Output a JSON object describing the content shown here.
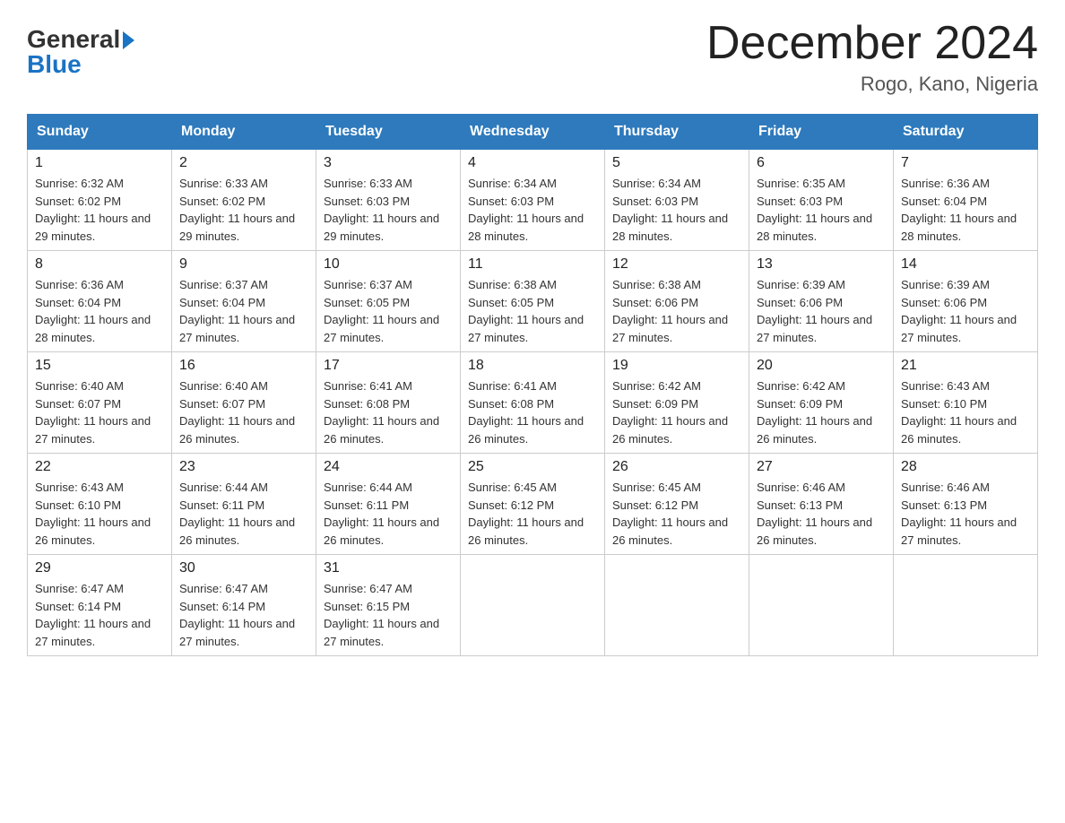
{
  "logo": {
    "text_general": "General",
    "text_blue": "Blue",
    "triangle_symbol": "▶"
  },
  "title": "December 2024",
  "location": "Rogo, Kano, Nigeria",
  "days_of_week": [
    "Sunday",
    "Monday",
    "Tuesday",
    "Wednesday",
    "Thursday",
    "Friday",
    "Saturday"
  ],
  "weeks": [
    [
      {
        "day": "1",
        "sunrise": "6:32 AM",
        "sunset": "6:02 PM",
        "daylight": "11 hours and 29 minutes."
      },
      {
        "day": "2",
        "sunrise": "6:33 AM",
        "sunset": "6:02 PM",
        "daylight": "11 hours and 29 minutes."
      },
      {
        "day": "3",
        "sunrise": "6:33 AM",
        "sunset": "6:03 PM",
        "daylight": "11 hours and 29 minutes."
      },
      {
        "day": "4",
        "sunrise": "6:34 AM",
        "sunset": "6:03 PM",
        "daylight": "11 hours and 28 minutes."
      },
      {
        "day": "5",
        "sunrise": "6:34 AM",
        "sunset": "6:03 PM",
        "daylight": "11 hours and 28 minutes."
      },
      {
        "day": "6",
        "sunrise": "6:35 AM",
        "sunset": "6:03 PM",
        "daylight": "11 hours and 28 minutes."
      },
      {
        "day": "7",
        "sunrise": "6:36 AM",
        "sunset": "6:04 PM",
        "daylight": "11 hours and 28 minutes."
      }
    ],
    [
      {
        "day": "8",
        "sunrise": "6:36 AM",
        "sunset": "6:04 PM",
        "daylight": "11 hours and 28 minutes."
      },
      {
        "day": "9",
        "sunrise": "6:37 AM",
        "sunset": "6:04 PM",
        "daylight": "11 hours and 27 minutes."
      },
      {
        "day": "10",
        "sunrise": "6:37 AM",
        "sunset": "6:05 PM",
        "daylight": "11 hours and 27 minutes."
      },
      {
        "day": "11",
        "sunrise": "6:38 AM",
        "sunset": "6:05 PM",
        "daylight": "11 hours and 27 minutes."
      },
      {
        "day": "12",
        "sunrise": "6:38 AM",
        "sunset": "6:06 PM",
        "daylight": "11 hours and 27 minutes."
      },
      {
        "day": "13",
        "sunrise": "6:39 AM",
        "sunset": "6:06 PM",
        "daylight": "11 hours and 27 minutes."
      },
      {
        "day": "14",
        "sunrise": "6:39 AM",
        "sunset": "6:06 PM",
        "daylight": "11 hours and 27 minutes."
      }
    ],
    [
      {
        "day": "15",
        "sunrise": "6:40 AM",
        "sunset": "6:07 PM",
        "daylight": "11 hours and 27 minutes."
      },
      {
        "day": "16",
        "sunrise": "6:40 AM",
        "sunset": "6:07 PM",
        "daylight": "11 hours and 26 minutes."
      },
      {
        "day": "17",
        "sunrise": "6:41 AM",
        "sunset": "6:08 PM",
        "daylight": "11 hours and 26 minutes."
      },
      {
        "day": "18",
        "sunrise": "6:41 AM",
        "sunset": "6:08 PM",
        "daylight": "11 hours and 26 minutes."
      },
      {
        "day": "19",
        "sunrise": "6:42 AM",
        "sunset": "6:09 PM",
        "daylight": "11 hours and 26 minutes."
      },
      {
        "day": "20",
        "sunrise": "6:42 AM",
        "sunset": "6:09 PM",
        "daylight": "11 hours and 26 minutes."
      },
      {
        "day": "21",
        "sunrise": "6:43 AM",
        "sunset": "6:10 PM",
        "daylight": "11 hours and 26 minutes."
      }
    ],
    [
      {
        "day": "22",
        "sunrise": "6:43 AM",
        "sunset": "6:10 PM",
        "daylight": "11 hours and 26 minutes."
      },
      {
        "day": "23",
        "sunrise": "6:44 AM",
        "sunset": "6:11 PM",
        "daylight": "11 hours and 26 minutes."
      },
      {
        "day": "24",
        "sunrise": "6:44 AM",
        "sunset": "6:11 PM",
        "daylight": "11 hours and 26 minutes."
      },
      {
        "day": "25",
        "sunrise": "6:45 AM",
        "sunset": "6:12 PM",
        "daylight": "11 hours and 26 minutes."
      },
      {
        "day": "26",
        "sunrise": "6:45 AM",
        "sunset": "6:12 PM",
        "daylight": "11 hours and 26 minutes."
      },
      {
        "day": "27",
        "sunrise": "6:46 AM",
        "sunset": "6:13 PM",
        "daylight": "11 hours and 26 minutes."
      },
      {
        "day": "28",
        "sunrise": "6:46 AM",
        "sunset": "6:13 PM",
        "daylight": "11 hours and 27 minutes."
      }
    ],
    [
      {
        "day": "29",
        "sunrise": "6:47 AM",
        "sunset": "6:14 PM",
        "daylight": "11 hours and 27 minutes."
      },
      {
        "day": "30",
        "sunrise": "6:47 AM",
        "sunset": "6:14 PM",
        "daylight": "11 hours and 27 minutes."
      },
      {
        "day": "31",
        "sunrise": "6:47 AM",
        "sunset": "6:15 PM",
        "daylight": "11 hours and 27 minutes."
      },
      null,
      null,
      null,
      null
    ]
  ],
  "colors": {
    "header_bg": "#2e7abd",
    "header_text": "#ffffff",
    "border": "#cccccc",
    "body_text": "#333333"
  }
}
